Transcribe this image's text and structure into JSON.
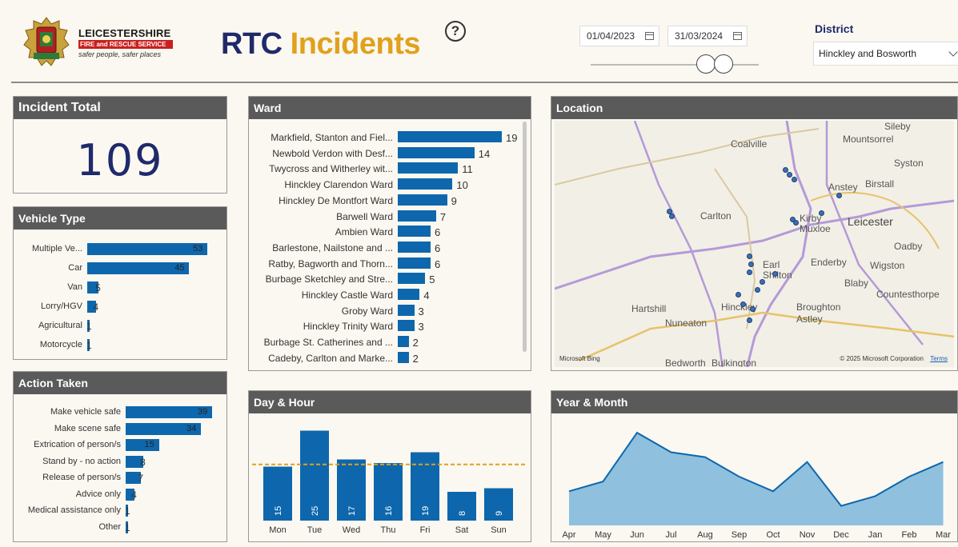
{
  "header": {
    "brand_line1": "LEICESTERSHIRE",
    "brand_line2": "FIRE and RESCUE SERVICE",
    "brand_line3": "safer people, safer places",
    "title_part1": "RTC",
    "title_part2": "Incidents",
    "help_glyph": "?",
    "start_date": "01/04/2023",
    "end_date": "31/03/2024",
    "district_label": "District",
    "district_value": "Hinckley and Bosworth"
  },
  "colors": {
    "bar": "#0e67ac",
    "title_blue": "#1f2a6b",
    "title_gold": "#e0a11c",
    "area_fill": "#8fc0dd",
    "avg_line": "#e0a11c"
  },
  "incident_total": {
    "title": "Incident Total",
    "value": "109"
  },
  "vehicle_type": {
    "title": "Vehicle Type",
    "items": [
      {
        "label": "Multiple Ve...",
        "value": 53
      },
      {
        "label": "Car",
        "value": 45
      },
      {
        "label": "Van",
        "value": 5
      },
      {
        "label": "Lorry/HGV",
        "value": 4
      },
      {
        "label": "Agricultural",
        "value": 1
      },
      {
        "label": "Motorcycle",
        "value": 1
      }
    ]
  },
  "action_taken": {
    "title": "Action Taken",
    "items": [
      {
        "label": "Make vehicle safe",
        "value": 39
      },
      {
        "label": "Make scene safe",
        "value": 34
      },
      {
        "label": "Extrication of person/s",
        "value": 15
      },
      {
        "label": "Stand by - no action",
        "value": 8
      },
      {
        "label": "Release of person/s",
        "value": 7
      },
      {
        "label": "Advice only",
        "value": 4
      },
      {
        "label": "Medical assistance only",
        "value": 1
      },
      {
        "label": "Other",
        "value": 1
      }
    ]
  },
  "ward": {
    "title": "Ward",
    "items": [
      {
        "label": "Markfield, Stanton and Fiel...",
        "value": 19
      },
      {
        "label": "Newbold Verdon with Desf...",
        "value": 14
      },
      {
        "label": "Twycross and Witherley wit...",
        "value": 11
      },
      {
        "label": "Hinckley Clarendon Ward",
        "value": 10
      },
      {
        "label": "Hinckley De Montfort Ward",
        "value": 9
      },
      {
        "label": "Barwell Ward",
        "value": 7
      },
      {
        "label": "Ambien Ward",
        "value": 6
      },
      {
        "label": "Barlestone, Nailstone and ...",
        "value": 6
      },
      {
        "label": "Ratby, Bagworth and Thorn...",
        "value": 6
      },
      {
        "label": "Burbage Sketchley and Stre...",
        "value": 5
      },
      {
        "label": "Hinckley Castle Ward",
        "value": 4
      },
      {
        "label": "Groby Ward",
        "value": 3
      },
      {
        "label": "Hinckley Trinity Ward",
        "value": 3
      },
      {
        "label": "Burbage St. Catherines and ...",
        "value": 2
      },
      {
        "label": "Cadeby, Carlton and Marke...",
        "value": 2
      }
    ]
  },
  "location": {
    "title": "Location",
    "places": [
      "Sileby",
      "Mountsorrel",
      "Coalville",
      "Syston",
      "Anstey",
      "Birstall",
      "Carlton",
      "Kirby Muxloe",
      "Leicester",
      "Oadby",
      "Earl Shilton",
      "Enderby",
      "Wigston",
      "Blaby",
      "Countesthorpe",
      "Hartshill",
      "Hinckley",
      "Broughton Astley",
      "Nuneaton",
      "Bedworth",
      "Bulkington"
    ],
    "attribution_left": "Microsoft Bing",
    "attribution_right": "© 2025 Microsoft Corporation",
    "terms": "Terms"
  },
  "chart_data": [
    {
      "type": "bar",
      "title": "Day & Hour",
      "categories": [
        "Mon",
        "Tue",
        "Wed",
        "Thu",
        "Fri",
        "Sat",
        "Sun"
      ],
      "values": [
        15,
        25,
        17,
        16,
        19,
        8,
        9
      ],
      "average_line": 15.6,
      "ylim": [
        0,
        28
      ]
    },
    {
      "type": "area",
      "title": "Year & Month",
      "categories": [
        "Apr",
        "May",
        "Jun",
        "Jul",
        "Aug",
        "Sep",
        "Oct",
        "Nov",
        "Dec",
        "Jan",
        "Feb",
        "Mar"
      ],
      "values": [
        7,
        9,
        19,
        15,
        14,
        10,
        7,
        13,
        4,
        6,
        10,
        13
      ],
      "ylim": [
        0,
        20
      ]
    }
  ]
}
